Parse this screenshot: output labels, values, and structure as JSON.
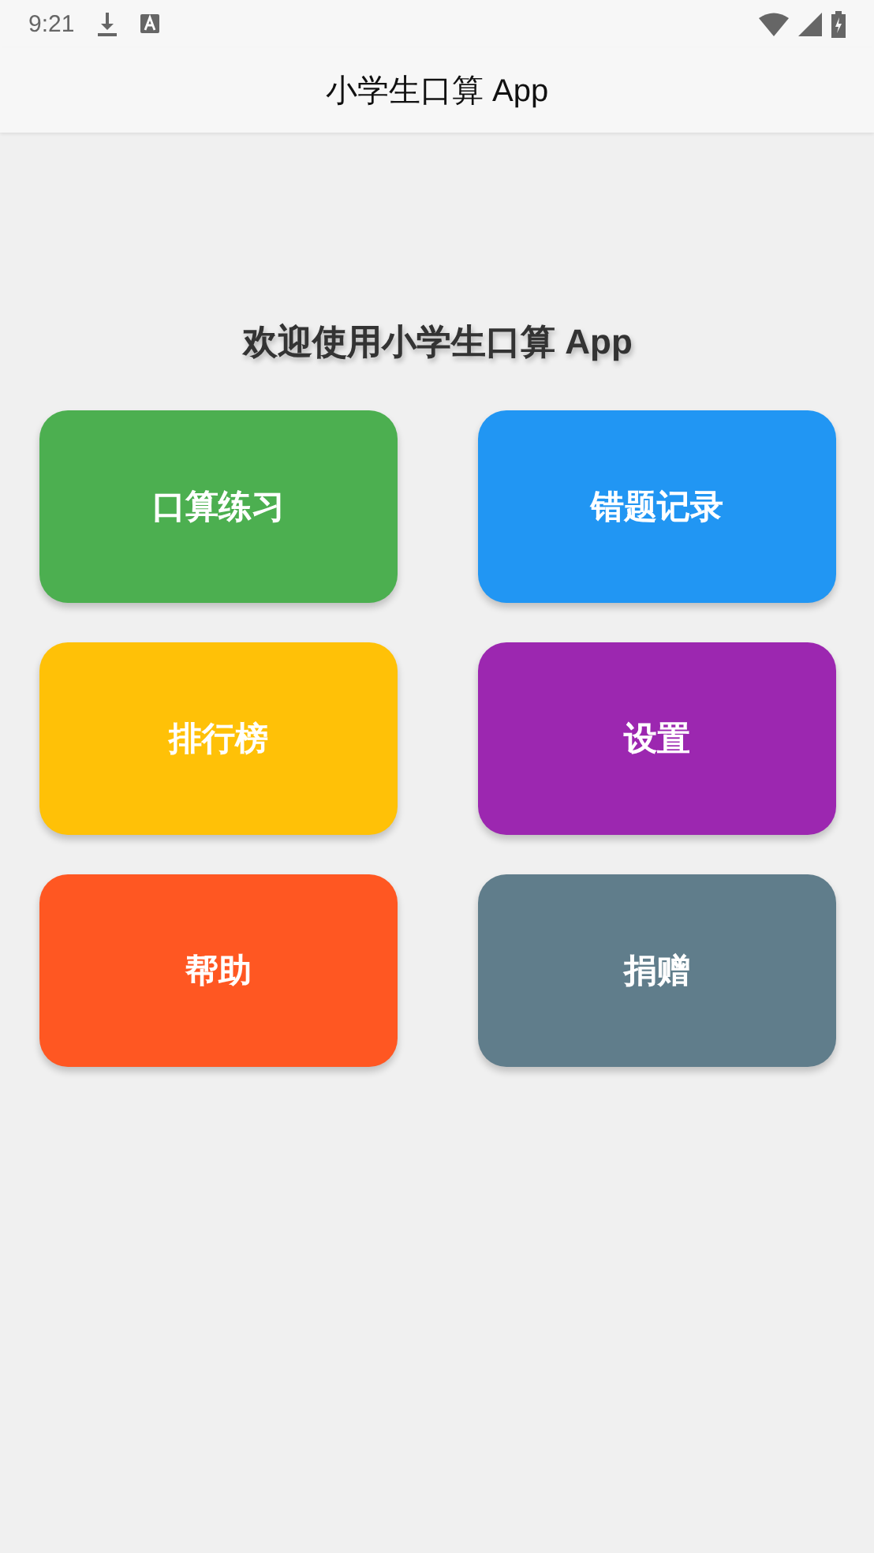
{
  "status_bar": {
    "time": "9:21"
  },
  "app_bar": {
    "title": "小学生口算 App"
  },
  "welcome": "欢迎使用小学生口算 App",
  "menu_buttons": [
    {
      "label": "口算练习",
      "color": "#4caf50"
    },
    {
      "label": "错题记录",
      "color": "#2196f3"
    },
    {
      "label": "排行榜",
      "color": "#ffc107"
    },
    {
      "label": "设置",
      "color": "#9c27b0"
    },
    {
      "label": "帮助",
      "color": "#ff5722"
    },
    {
      "label": "捐赠",
      "color": "#607d8b"
    }
  ]
}
